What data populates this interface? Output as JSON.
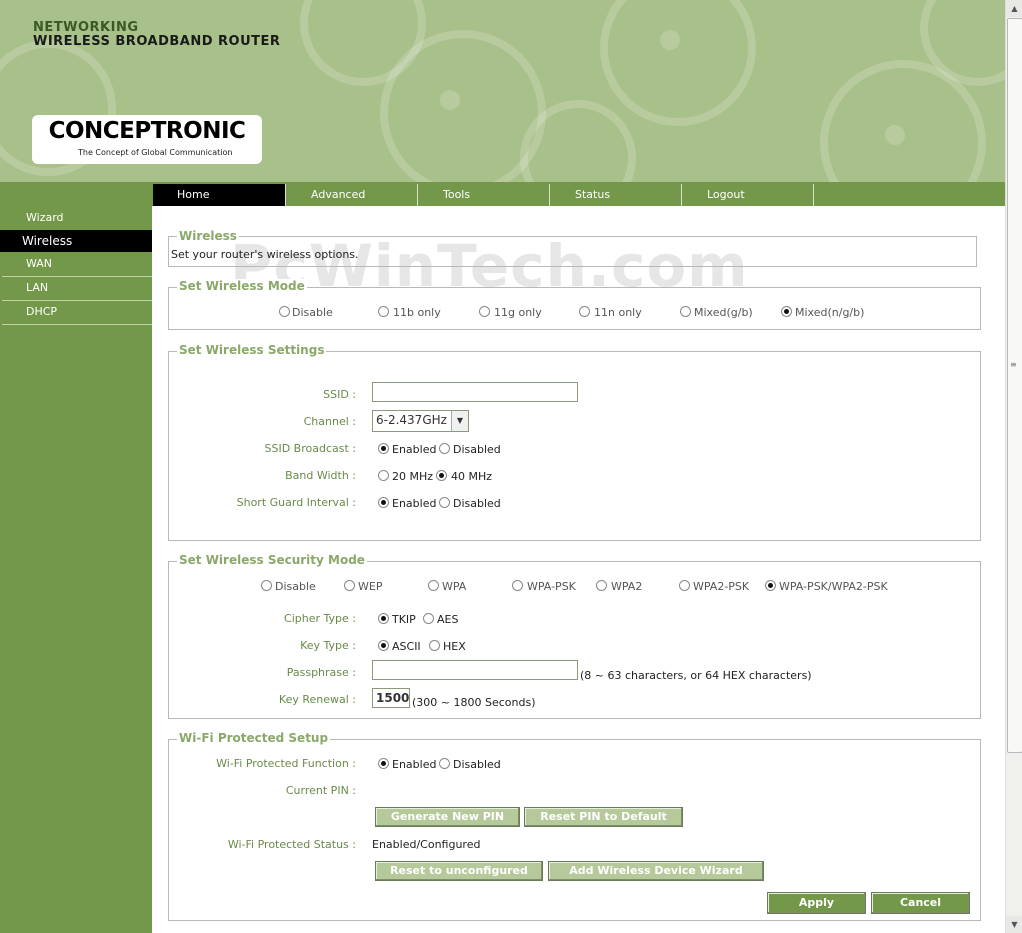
{
  "header": {
    "line1": "NETWORKING",
    "line2": "WIRELESS BROADBAND ROUTER",
    "logo": "CONCEPTRONIC",
    "tagline": "The Concept of Global Communication"
  },
  "nav": {
    "tabs": [
      {
        "label": "Home",
        "active": true
      },
      {
        "label": "Advanced"
      },
      {
        "label": "Tools"
      },
      {
        "label": "Status"
      },
      {
        "label": "Logout"
      }
    ]
  },
  "sidebar": {
    "items": [
      {
        "label": "Wizard"
      },
      {
        "label": "Wireless",
        "active": true
      },
      {
        "label": "WAN"
      },
      {
        "label": "LAN"
      },
      {
        "label": "DHCP"
      }
    ]
  },
  "watermark": "PcWinTech.com",
  "wireless": {
    "legend": "Wireless",
    "description": "Set your router's wireless options."
  },
  "wireless_mode": {
    "legend": "Set Wireless Mode",
    "options": [
      "Disable",
      "11b only",
      "11g only",
      "11n only",
      "Mixed(g/b)",
      "Mixed(n/g/b)"
    ],
    "selected": "Mixed(n/g/b)"
  },
  "settings": {
    "legend": "Set Wireless Settings",
    "ssid_label": "SSID :",
    "ssid_value": "",
    "channel_label": "Channel :",
    "channel_value": "6-2.437GHz",
    "ssid_broadcast_label": "SSID Broadcast :",
    "band_width_label": "Band Width :",
    "short_guard_label": "Short Guard Interval :",
    "enabled": "Enabled",
    "disabled": "Disabled",
    "bw_20": "20 MHz",
    "bw_40": "40 MHz"
  },
  "security": {
    "legend": "Set Wireless Security Mode",
    "modes": [
      "Disable",
      "WEP",
      "WPA",
      "WPA-PSK",
      "WPA2",
      "WPA2-PSK",
      "WPA-PSK/WPA2-PSK"
    ],
    "selected": "WPA-PSK/WPA2-PSK",
    "cipher_label": "Cipher Type :",
    "cipher_tkip": "TKIP",
    "cipher_aes": "AES",
    "key_type_label": "Key Type :",
    "key_ascii": "ASCII",
    "key_hex": "HEX",
    "passphrase_label": "Passphrase :",
    "passphrase_hint": "(8 ~ 63 characters, or 64 HEX characters)",
    "key_renewal_label": "Key Renewal :",
    "key_renewal_value": "1500",
    "key_renewal_hint": "(300 ~ 1800 Seconds)"
  },
  "wps": {
    "legend": "Wi-Fi Protected Setup",
    "function_label": "Wi-Fi Protected Function :",
    "enabled": "Enabled",
    "disabled": "Disabled",
    "pin_label": "Current PIN :",
    "pin_value": "",
    "generate_pin": "Generate New PIN",
    "reset_pin": "Reset PIN to Default",
    "status_label": "Wi-Fi Protected Status :",
    "status_value": "Enabled/Configured",
    "reset_unconfigured": "Reset to unconfigured",
    "add_device": "Add Wireless Device Wizard"
  },
  "actions": {
    "apply": "Apply",
    "cancel": "Cancel"
  }
}
